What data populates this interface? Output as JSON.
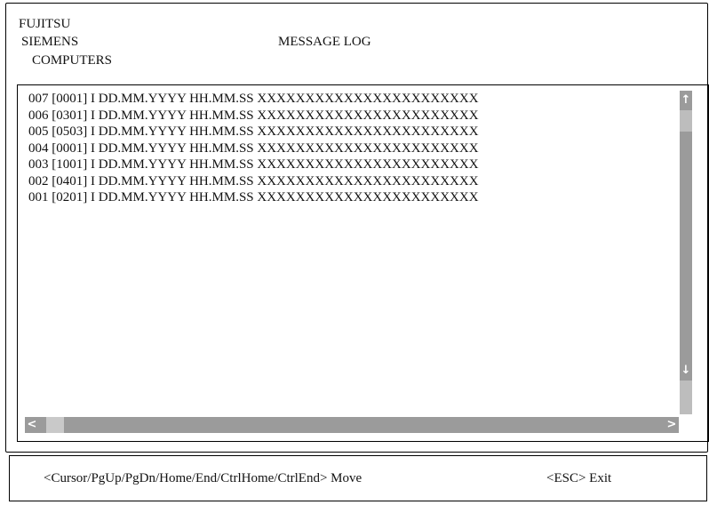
{
  "header": {
    "brand_line1": "FUJITSU",
    "brand_line2": "SIEMENS",
    "brand_line3": "COMPUTERS",
    "title": "MESSAGE LOG"
  },
  "log": {
    "entries": [
      "007 [0001] I DD.MM.YYYY HH.MM.SS XXXXXXXXXXXXXXXXXXXXXXX",
      "006 [0301] I DD.MM.YYYY HH.MM.SS XXXXXXXXXXXXXXXXXXXXXXX",
      "005 [0503] I DD.MM.YYYY HH.MM.SS XXXXXXXXXXXXXXXXXXXXXXX",
      "004 [0001] I DD.MM.YYYY HH.MM.SS XXXXXXXXXXXXXXXXXXXXXXX",
      "003 [1001] I DD.MM.YYYY HH.MM.SS XXXXXXXXXXXXXXXXXXXXXXX",
      "002 [0401] I DD.MM.YYYY HH.MM.SS XXXXXXXXXXXXXXXXXXXXXXX",
      "001 [0201] I DD.MM.YYYY HH.MM.SS XXXXXXXXXXXXXXXXXXXXXXX"
    ]
  },
  "scrollbars": {
    "vertical_up_glyph": "↑",
    "vertical_down_glyph": "↓",
    "horizontal_left_glyph": "<",
    "horizontal_right_glyph": ">"
  },
  "footer": {
    "move_hint": "<Cursor/PgUp/PgDn/Home/End/CtrlHome/CtrlEnd> Move",
    "exit_hint": "<ESC> Exit"
  },
  "colors": {
    "scrollbar_track": "#bdbdbd",
    "scrollbar_thumb": "#9b9b9b",
    "border": "#000000",
    "background": "#ffffff"
  }
}
